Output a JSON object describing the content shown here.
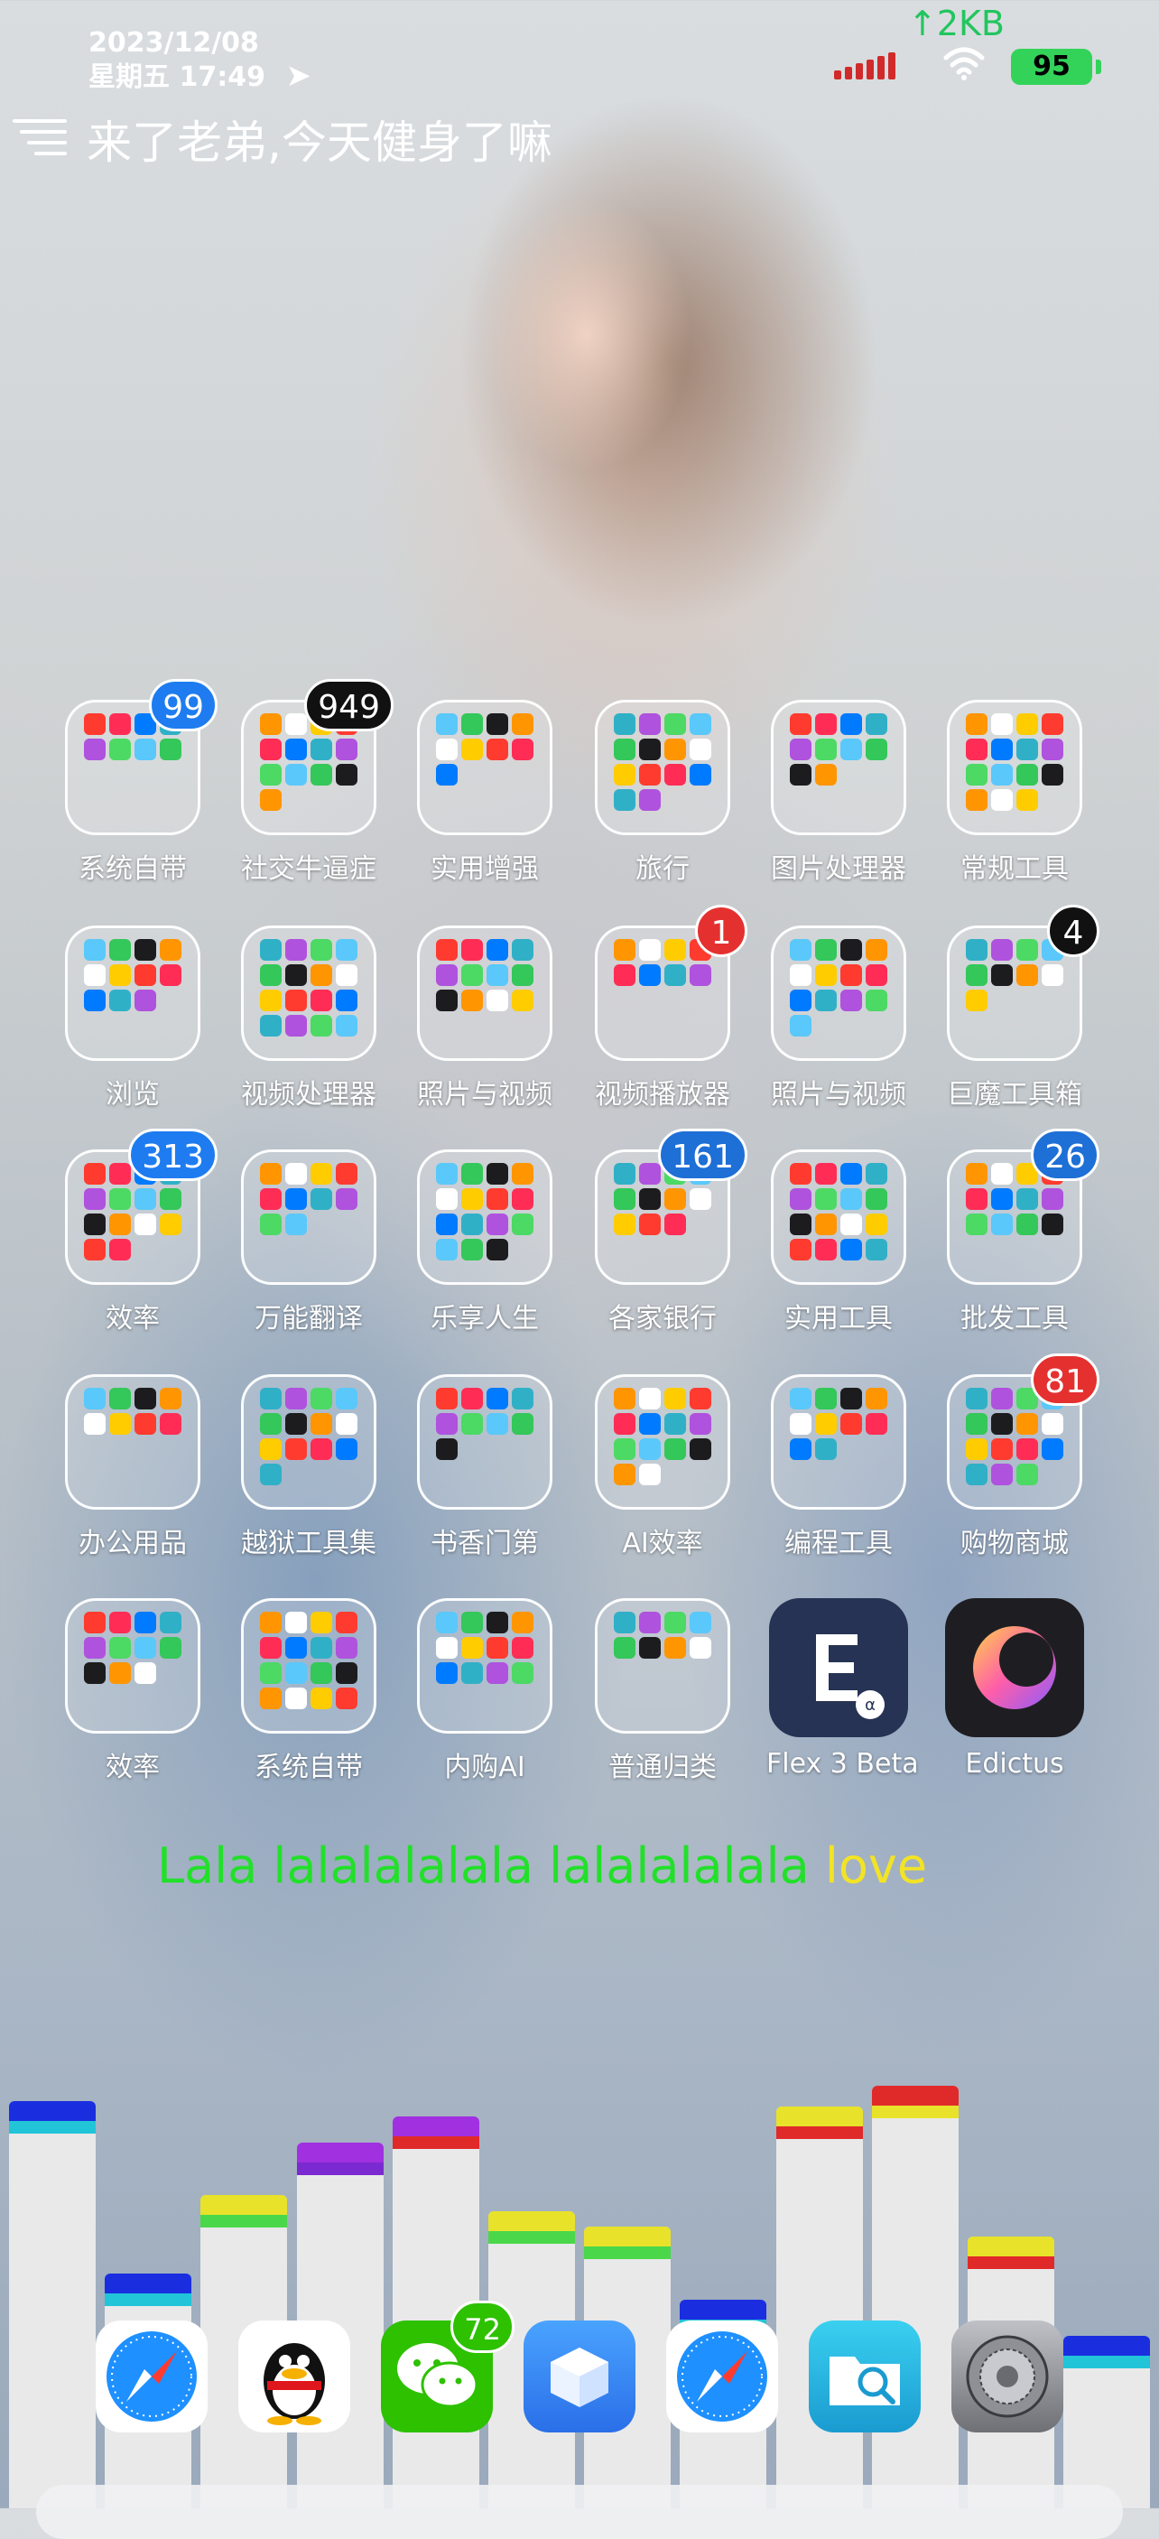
{
  "status": {
    "date": "2023/12/08",
    "weekday_time": "星期五 17:49",
    "network_speed": "↑2KB",
    "battery": "95",
    "greeting": "来了老弟,今天健身了嘛"
  },
  "apps": [
    {
      "label": "系统自带",
      "badge": "99",
      "badge_color": "#1e7cf0"
    },
    {
      "label": "社交牛逼症",
      "badge": "949",
      "badge_color": "#111111"
    },
    {
      "label": "实用增强",
      "badge": "",
      "badge_color": ""
    },
    {
      "label": "旅行",
      "badge": "",
      "badge_color": ""
    },
    {
      "label": "图片处理器",
      "badge": "",
      "badge_color": ""
    },
    {
      "label": "常规工具",
      "badge": "",
      "badge_color": ""
    },
    {
      "label": "浏览",
      "badge": "",
      "badge_color": ""
    },
    {
      "label": "视频处理器",
      "badge": "",
      "badge_color": ""
    },
    {
      "label": "照片与视频",
      "badge": "",
      "badge_color": ""
    },
    {
      "label": "视频播放器",
      "badge": "1",
      "badge_color": "#e53030"
    },
    {
      "label": "照片与视频",
      "badge": "",
      "badge_color": ""
    },
    {
      "label": "巨魔工具箱",
      "badge": "4",
      "badge_color": "#111111"
    },
    {
      "label": "效率",
      "badge": "313",
      "badge_color": "#1e7cf0"
    },
    {
      "label": "万能翻译",
      "badge": "",
      "badge_color": ""
    },
    {
      "label": "乐享人生",
      "badge": "",
      "badge_color": ""
    },
    {
      "label": "各家银行",
      "badge": "161",
      "badge_color": "#1e6fd6"
    },
    {
      "label": "实用工具",
      "badge": "",
      "badge_color": ""
    },
    {
      "label": "批发工具",
      "badge": "26",
      "badge_color": "#1e6fd6"
    },
    {
      "label": "办公用品",
      "badge": "",
      "badge_color": ""
    },
    {
      "label": "越狱工具集",
      "badge": "",
      "badge_color": ""
    },
    {
      "label": "书香门第",
      "badge": "",
      "badge_color": ""
    },
    {
      "label": "AI效率",
      "badge": "",
      "badge_color": ""
    },
    {
      "label": "编程工具",
      "badge": "",
      "badge_color": ""
    },
    {
      "label": "购物商城",
      "badge": "81",
      "badge_color": "#e53030"
    },
    {
      "label": "效率",
      "badge": "",
      "badge_color": ""
    },
    {
      "label": "系统自带",
      "badge": "",
      "badge_color": ""
    },
    {
      "label": "内购AI",
      "badge": "",
      "badge_color": ""
    },
    {
      "label": "普通归类",
      "badge": "",
      "badge_color": ""
    },
    {
      "label": "Flex 3 Beta",
      "badge": "",
      "badge_color": "",
      "icon": "flex-app-icon"
    },
    {
      "label": "Edictus",
      "badge": "",
      "badge_color": "",
      "icon": "edictus-app-icon"
    }
  ],
  "lyric": {
    "green": "Lala lalalalalala lalalalalala ",
    "yellow": "love"
  },
  "visualizer_levels": [
    0.78,
    0.45,
    0.6,
    0.7,
    0.75,
    0.57,
    0.54,
    0.4,
    0.77,
    0.81,
    0.52,
    0.33
  ],
  "dock": [
    {
      "icon": "safari-icon",
      "badge": ""
    },
    {
      "icon": "qq-icon",
      "badge": ""
    },
    {
      "icon": "wechat-icon",
      "badge": "72"
    },
    {
      "icon": "package-box-icon",
      "badge": ""
    },
    {
      "icon": "safari-icon",
      "badge": ""
    },
    {
      "icon": "file-search-icon",
      "badge": ""
    },
    {
      "icon": "settings-gear-icon",
      "badge": ""
    }
  ]
}
